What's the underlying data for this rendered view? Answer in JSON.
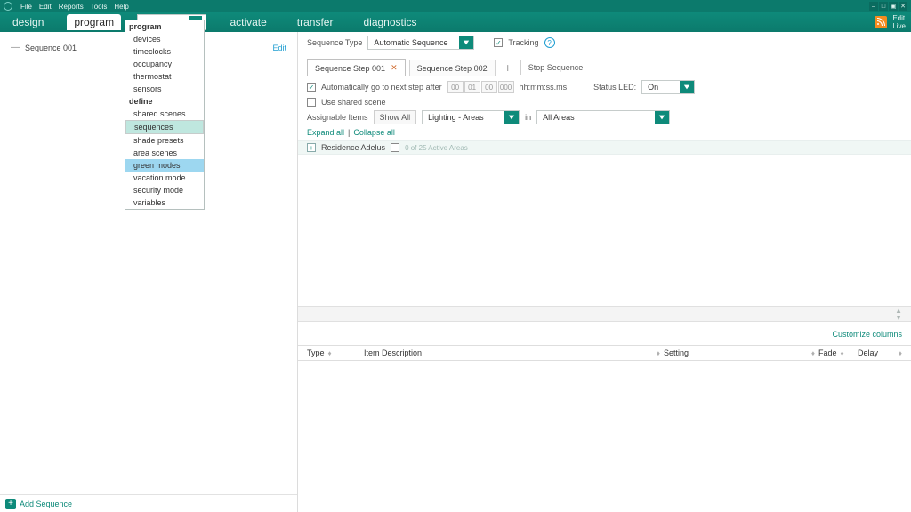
{
  "menubar": {
    "items": [
      "File",
      "Edit",
      "Reports",
      "Tools",
      "Help"
    ]
  },
  "tabs": {
    "design": "design",
    "program": "program",
    "activate": "activate",
    "transfer": "transfer",
    "diagnostics": "diagnostics",
    "subselect": "sequences",
    "live_a": "Edit",
    "live_b": "Live"
  },
  "dropdown": {
    "group1": "program",
    "g1": [
      "devices",
      "timeclocks",
      "occupancy",
      "thermostat",
      "sensors"
    ],
    "group2": "define",
    "g2": [
      "shared scenes",
      "sequences",
      "shade presets",
      "area scenes",
      "green modes",
      "vacation mode",
      "security mode",
      "variables"
    ]
  },
  "left": {
    "seq001": "Sequence 001",
    "edit": "Edit",
    "add": "Add Sequence"
  },
  "seq": {
    "type_label": "Sequence Type",
    "type_value": "Automatic Sequence",
    "tracking": "Tracking",
    "steps": {
      "s1": "Sequence Step 001",
      "s2": "Sequence Step 002",
      "stop": "Stop Sequence"
    },
    "auto_label": "Automatically go to next step after",
    "time": [
      "00",
      "01",
      "00",
      "000"
    ],
    "time_fmt": "hh:mm:ss.ms",
    "status_led_label": "Status LED:",
    "status_led_value": "On",
    "use_shared": "Use shared scene",
    "assignable": "Assignable Items",
    "show_all": "Show All",
    "lighting": "Lighting - Areas",
    "in": "in",
    "all_areas": "All Areas",
    "expand": "Expand all",
    "collapse": "Collapse all",
    "residence": "Residence Adelus",
    "residence_sub": "0 of 25 Active Areas",
    "customize": "Customize columns"
  },
  "table": {
    "type": "Type",
    "desc": "Item Description",
    "setting": "Setting",
    "fade": "Fade",
    "delay": "Delay"
  }
}
